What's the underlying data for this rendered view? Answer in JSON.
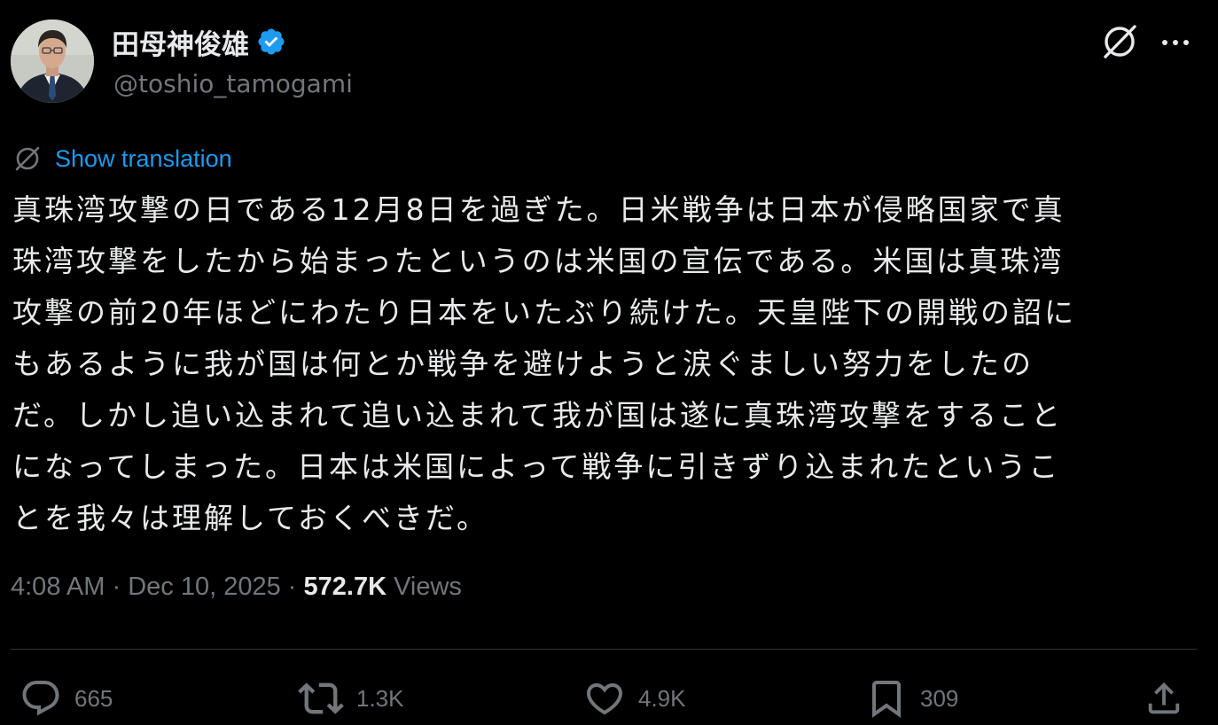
{
  "author": {
    "display_name": "田母神俊雄",
    "handle": "@toshio_tamogami",
    "verified_icon": "verified-badge-icon",
    "avatar": "profile-photo"
  },
  "header_icons": {
    "grok": "grok-icon",
    "more": "more-options-icon"
  },
  "translation": {
    "label": "Show translation",
    "icon": "grok-translate-icon"
  },
  "tweet": {
    "lines": [
      "真珠湾攻撃の日である12月8日を過ぎた。日米戦争は日本が侵略国家で真",
      "珠湾攻撃をしたから始まったというのは米国の宣伝である。米国は真珠湾",
      "攻撃の前20年ほどにわたり日本をいたぶり続けた。天皇陛下の開戦の詔に",
      "もあるように我が国は何とか戦争を避けようと涙ぐましい努力をしたの",
      "だ。しかし追い込まれて追い込まれて我が国は遂に真珠湾攻撃をすること",
      "になってしまった。日本は米国によって戦争に引きずり込まれたというこ",
      "とを我々は理解しておくべきだ。"
    ]
  },
  "meta": {
    "time": "4:08 AM",
    "separator": "·",
    "date": "Dec 10, 2025",
    "views_count": "572.7K",
    "views_label": "Views"
  },
  "actions": {
    "reply": {
      "icon": "reply-icon",
      "count": "665"
    },
    "repost": {
      "icon": "repost-icon",
      "count": "1.3K"
    },
    "like": {
      "icon": "heart-icon",
      "count": "4.9K"
    },
    "bookmark": {
      "icon": "bookmark-icon",
      "count": "309"
    },
    "share": {
      "icon": "share-icon"
    }
  },
  "colors": {
    "background": "#000000",
    "text": "#e7e9ea",
    "secondary": "#71767b",
    "accent": "#1d9bf0",
    "divider": "#2f3336"
  }
}
